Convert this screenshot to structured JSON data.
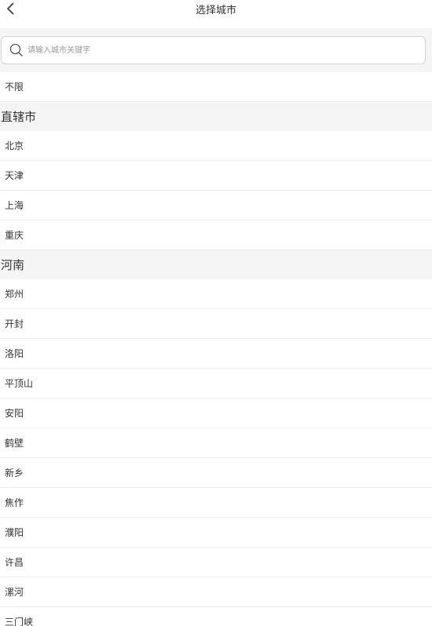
{
  "header": {
    "title": "选择城市"
  },
  "search": {
    "placeholder": "请输入城市关键字"
  },
  "top_item": {
    "label": "不限"
  },
  "sections": [
    {
      "title": "直辖市",
      "cities": [
        "北京",
        "天津",
        "上海",
        "重庆"
      ]
    },
    {
      "title": "河南",
      "cities": [
        "郑州",
        "开封",
        "洛阳",
        "平顶山",
        "安阳",
        "鹤壁",
        "新乡",
        "焦作",
        "濮阳",
        "许昌",
        "漯河",
        "三门峡"
      ]
    }
  ],
  "icons": {
    "back": "chevron-left-icon",
    "search": "search-icon"
  },
  "colors": {
    "section_bg": "#f5f5f5",
    "text": "#333333",
    "divider": "#ededed",
    "placeholder": "#9a9a9a"
  }
}
